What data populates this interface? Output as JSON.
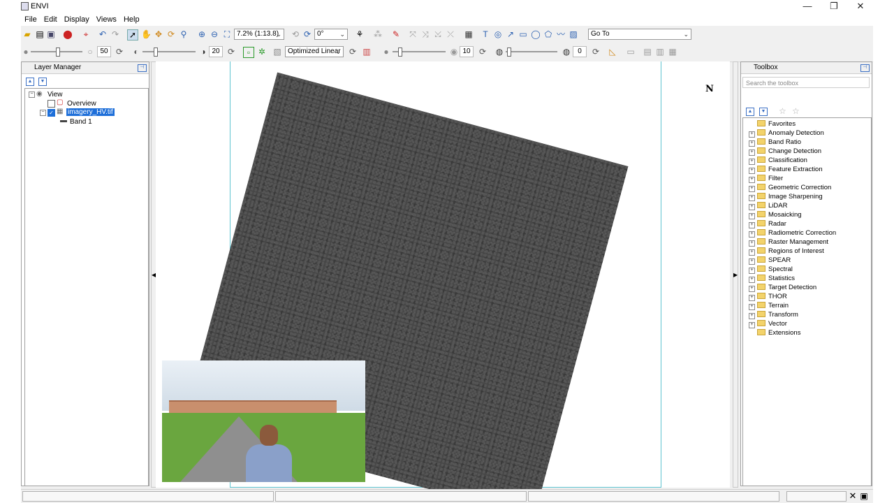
{
  "window": {
    "title": "ENVI",
    "controls": [
      "—",
      "❐",
      "✕"
    ]
  },
  "menu": [
    "File",
    "Edit",
    "Display",
    "Views",
    "Help"
  ],
  "toolbar1": {
    "zoom_value": "7.2% (1:13.8)",
    "rotation_value": "0°",
    "goto_value": "Go To"
  },
  "toolbar2": {
    "brightness": "50",
    "contrast": "20",
    "stretch_value": "Optimized Linear",
    "sharpen": "10",
    "transparency": "0"
  },
  "layer_manager": {
    "title": "Layer Manager",
    "root": "View",
    "items": [
      {
        "label": "Overview",
        "checked": false
      },
      {
        "label": "imagery_HV.tif",
        "checked": true,
        "selected": true
      },
      {
        "label": "Band 1"
      }
    ]
  },
  "toolbox": {
    "title": "Toolbox",
    "search_placeholder": "Search the toolbox",
    "items": [
      "Favorites",
      "Anomaly Detection",
      "Band Ratio",
      "Change Detection",
      "Classification",
      "Feature Extraction",
      "Filter",
      "Geometric Correction",
      "Image Sharpening",
      "LiDAR",
      "Mosaicking",
      "Radar",
      "Radiometric Correction",
      "Raster Management",
      "Regions of Interest",
      "SPEAR",
      "Spectral",
      "Statistics",
      "Target Detection",
      "THOR",
      "Terrain",
      "Transform",
      "Vector",
      "Extensions"
    ]
  },
  "north_arrow": "N",
  "colors": {
    "selection": "#1e6fd9",
    "view_border": "#5fc3d0",
    "folder": "#f3d36b"
  }
}
